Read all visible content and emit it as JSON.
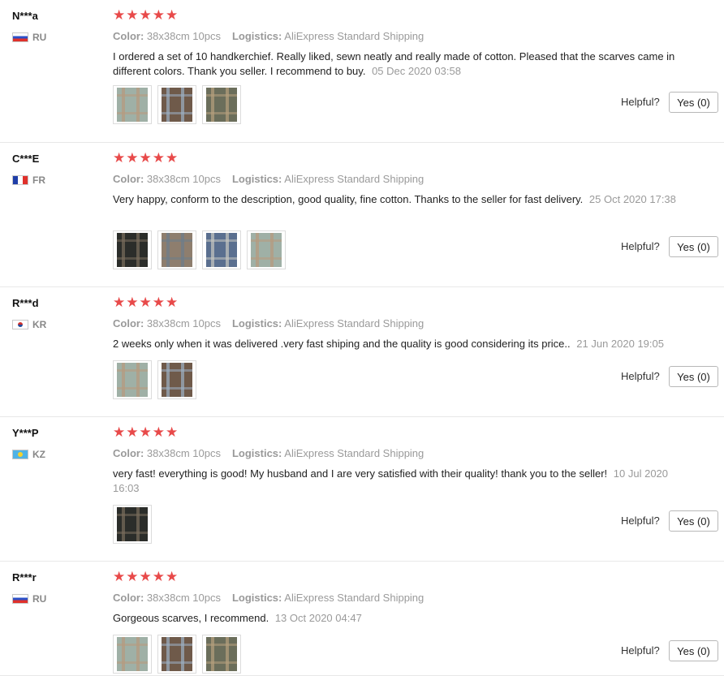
{
  "colors": {
    "star": "#e84a4a",
    "muted": "#9a9a9a",
    "text": "#222222",
    "divider": "#e8e8e8"
  },
  "labels": {
    "color_label": "Color:",
    "logistics_label": "Logistics:",
    "helpful": "Helpful?"
  },
  "reviews": [
    {
      "user": "N***a",
      "country": "RU",
      "flag": "ru-flag-icon",
      "stars": 5,
      "color": "38x38cm 10pcs",
      "logistics": "AliExpress Standard Shipping",
      "text": "I ordered a set of 10 handkerchief. Really liked, sewn neatly and really made of cotton. Pleased that the scarves came in different colors. Thank you seller. I recommend to buy.",
      "date": "05 Dec 2020 03:58",
      "photos": [
        "photo-handkerchief",
        "photo-handkerchief",
        "photo-handkerchief"
      ],
      "helpful_button": "Yes (0)"
    },
    {
      "user": "C***E",
      "country": "FR",
      "flag": "fr-flag-icon",
      "stars": 5,
      "color": "38x38cm 10pcs",
      "logistics": "AliExpress Standard Shipping",
      "text": "Very happy, conform to the description, good quality, fine cotton. Thanks to the seller for fast delivery.",
      "date": "25 Oct 2020 17:38",
      "photos": [
        "photo-handkerchief",
        "photo-handkerchief",
        "photo-handkerchief",
        "photo-handkerchief"
      ],
      "helpful_button": "Yes (0)"
    },
    {
      "user": "R***d",
      "country": "KR",
      "flag": "kr-flag-icon",
      "stars": 5,
      "color": "38x38cm 10pcs",
      "logistics": "AliExpress Standard Shipping",
      "text": "2 weeks only when it was delivered .very fast shiping and the quality is good considering its price..",
      "date": "21 Jun 2020 19:05",
      "photos": [
        "photo-handkerchief",
        "photo-handkerchief"
      ],
      "helpful_button": "Yes (0)"
    },
    {
      "user": "Y***P",
      "country": "KZ",
      "flag": "kz-flag-icon",
      "stars": 5,
      "color": "38x38cm 10pcs",
      "logistics": "AliExpress Standard Shipping",
      "text": "very fast! everything is good! My husband and I are very satisfied with their quality! thank you to the seller!",
      "date": "10 Jul 2020 16:03",
      "photos": [
        "photo-handkerchief"
      ],
      "helpful_button": "Yes (0)"
    },
    {
      "user": "R***r",
      "country": "RU",
      "flag": "ru-flag-icon",
      "stars": 5,
      "color": "38x38cm 10pcs",
      "logistics": "AliExpress Standard Shipping",
      "text": "Gorgeous scarves, I recommend.",
      "date": "13 Oct 2020 04:47",
      "photos": [
        "photo-handkerchief",
        "photo-handkerchief",
        "photo-handkerchief"
      ],
      "helpful_button": "Yes (0)"
    }
  ]
}
